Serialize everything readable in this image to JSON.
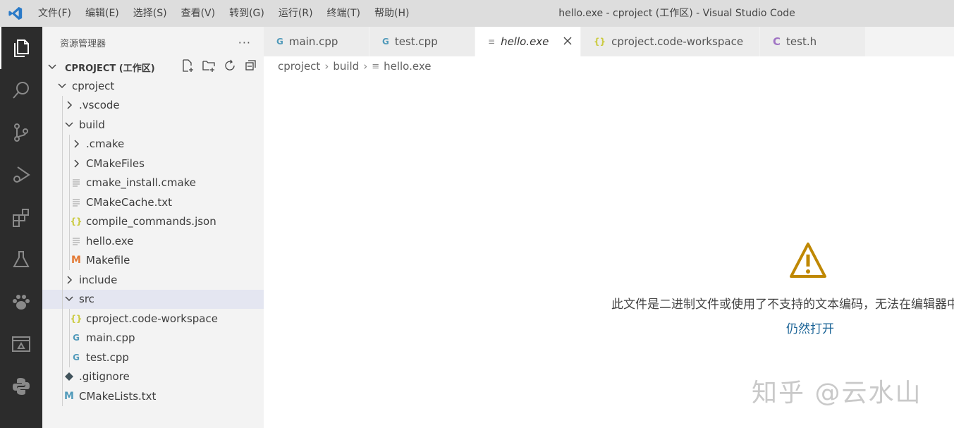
{
  "titlebar": {
    "menus": [
      "文件(F)",
      "编辑(E)",
      "选择(S)",
      "查看(V)",
      "转到(G)",
      "运行(R)",
      "终端(T)",
      "帮助(H)"
    ],
    "window_title": "hello.exe - cproject (工作区) - Visual Studio Code"
  },
  "activitybar": {
    "icons": [
      "explorer-icon",
      "search-icon",
      "source-control-icon",
      "run-debug-icon",
      "extensions-icon",
      "testing-icon",
      "paw-icon",
      "remote-explorer-icon",
      "python-icon"
    ]
  },
  "sidebar": {
    "title": "资源管理器",
    "more": "···",
    "workspace": "CPROJECT (工作区)",
    "tree": [
      {
        "label": "cproject",
        "depth": 0,
        "kind": "folder-open"
      },
      {
        "label": ".vscode",
        "depth": 1,
        "kind": "folder"
      },
      {
        "label": "build",
        "depth": 1,
        "kind": "folder-open"
      },
      {
        "label": ".cmake",
        "depth": 2,
        "kind": "folder"
      },
      {
        "label": "CMakeFiles",
        "depth": 2,
        "kind": "folder"
      },
      {
        "label": "cmake_install.cmake",
        "depth": 2,
        "kind": "file-text"
      },
      {
        "label": "CMakeCache.txt",
        "depth": 2,
        "kind": "file-text"
      },
      {
        "label": "compile_commands.json",
        "depth": 2,
        "kind": "file-json"
      },
      {
        "label": "hello.exe",
        "depth": 2,
        "kind": "file-text"
      },
      {
        "label": "Makefile",
        "depth": 2,
        "kind": "file-makefile"
      },
      {
        "label": "include",
        "depth": 1,
        "kind": "folder"
      },
      {
        "label": "src",
        "depth": 1,
        "kind": "folder-open",
        "selected": true
      },
      {
        "label": "cproject.code-workspace",
        "depth": 2,
        "kind": "file-json"
      },
      {
        "label": "main.cpp",
        "depth": 2,
        "kind": "file-cpp"
      },
      {
        "label": "test.cpp",
        "depth": 2,
        "kind": "file-cpp"
      },
      {
        "label": ".gitignore",
        "depth": 1,
        "kind": "file-git"
      },
      {
        "label": "CMakeLists.txt",
        "depth": 1,
        "kind": "file-cmake"
      }
    ]
  },
  "tabs": [
    {
      "label": "main.cpp",
      "icon": "G",
      "kind": "cpp",
      "active": false
    },
    {
      "label": "test.cpp",
      "icon": "G",
      "kind": "cpp",
      "active": false
    },
    {
      "label": "hello.exe",
      "icon": "≡",
      "kind": "text",
      "active": true
    },
    {
      "label": "cproject.code-workspace",
      "icon": "{}",
      "kind": "json",
      "active": false
    },
    {
      "label": "test.h",
      "icon": "C",
      "kind": "c-header",
      "active": false
    }
  ],
  "breadcrumb": {
    "items": [
      "cproject",
      "build",
      "hello.exe"
    ],
    "separator": "›"
  },
  "editor": {
    "message": "此文件是二进制文件或使用了不支持的文本编码，无法在编辑器中显示。",
    "open_anyway": "仍然打开"
  },
  "watermark": "知乎 @云水山",
  "colors": {
    "accent_blue": "#1a6396",
    "warning": "#bf8803",
    "cpp_icon": "#519aba",
    "json_icon": "#cbcb41",
    "makefile_icon": "#e37933",
    "cmake_icon": "#519aba",
    "c_header_icon": "#a074c4"
  }
}
